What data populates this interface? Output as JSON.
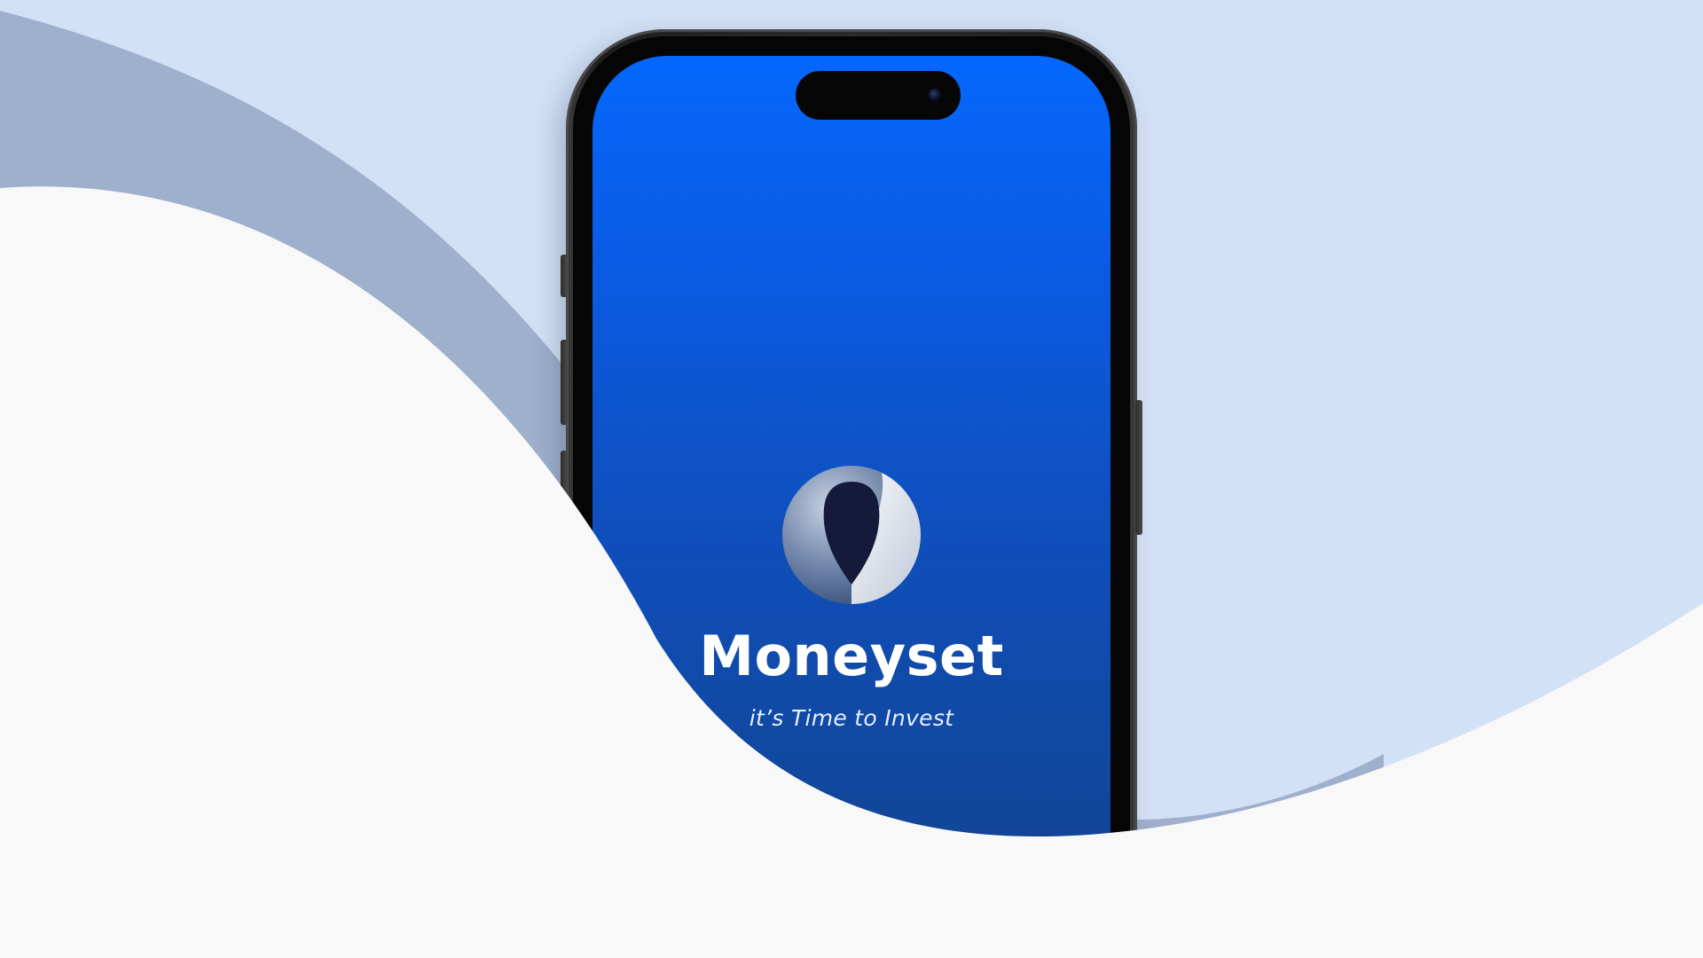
{
  "app": {
    "name": "Moneyset",
    "tagline": "it’s Time to Invest",
    "logo_icon": "moneyset-drop-logo-icon"
  },
  "colors": {
    "background_light_blue": "#d3e1f6",
    "background_wave_slate": "#9eb0cc",
    "background_white": "#f8f8f9",
    "screen_gradient_top": "#0467fd",
    "screen_gradient_bottom": "#133f88",
    "text_primary": "#ffffff"
  }
}
